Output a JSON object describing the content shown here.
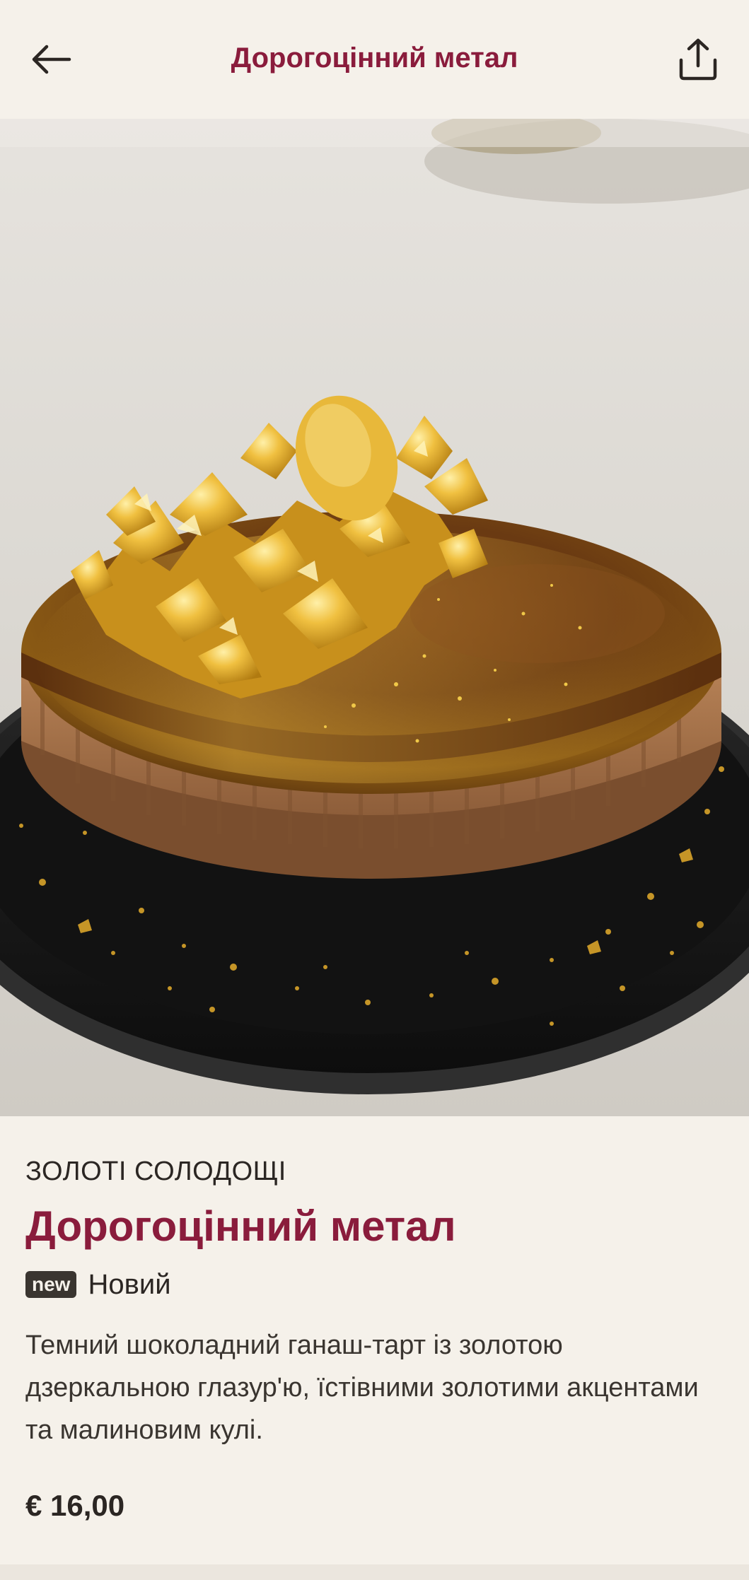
{
  "header": {
    "title": "Дорогоцінний метал",
    "back_icon": "arrow-left-icon",
    "share_icon": "share-icon"
  },
  "hero": {
    "image_icon": "product-photo",
    "colors": {
      "chocolate": "#6b3a14",
      "gold": "#e0a82a",
      "plate": "#141414",
      "crust": "#a8734a"
    }
  },
  "product": {
    "category": "ЗОЛОТІ СОЛОДОЩІ",
    "title": "Дорогоцінний метал",
    "badge": "new",
    "badge_label": "Новий",
    "description": "Темний шоколадний ганаш-тарт із золотою дзеркальною глазур'ю, їстівними золотими акцентами та малиновим кулі.",
    "price": "€ 16,00"
  },
  "colors": {
    "accent": "#8a1c3c",
    "background": "#f5f1ea",
    "text": "#2b2623",
    "badge_bg": "#3a3530"
  }
}
